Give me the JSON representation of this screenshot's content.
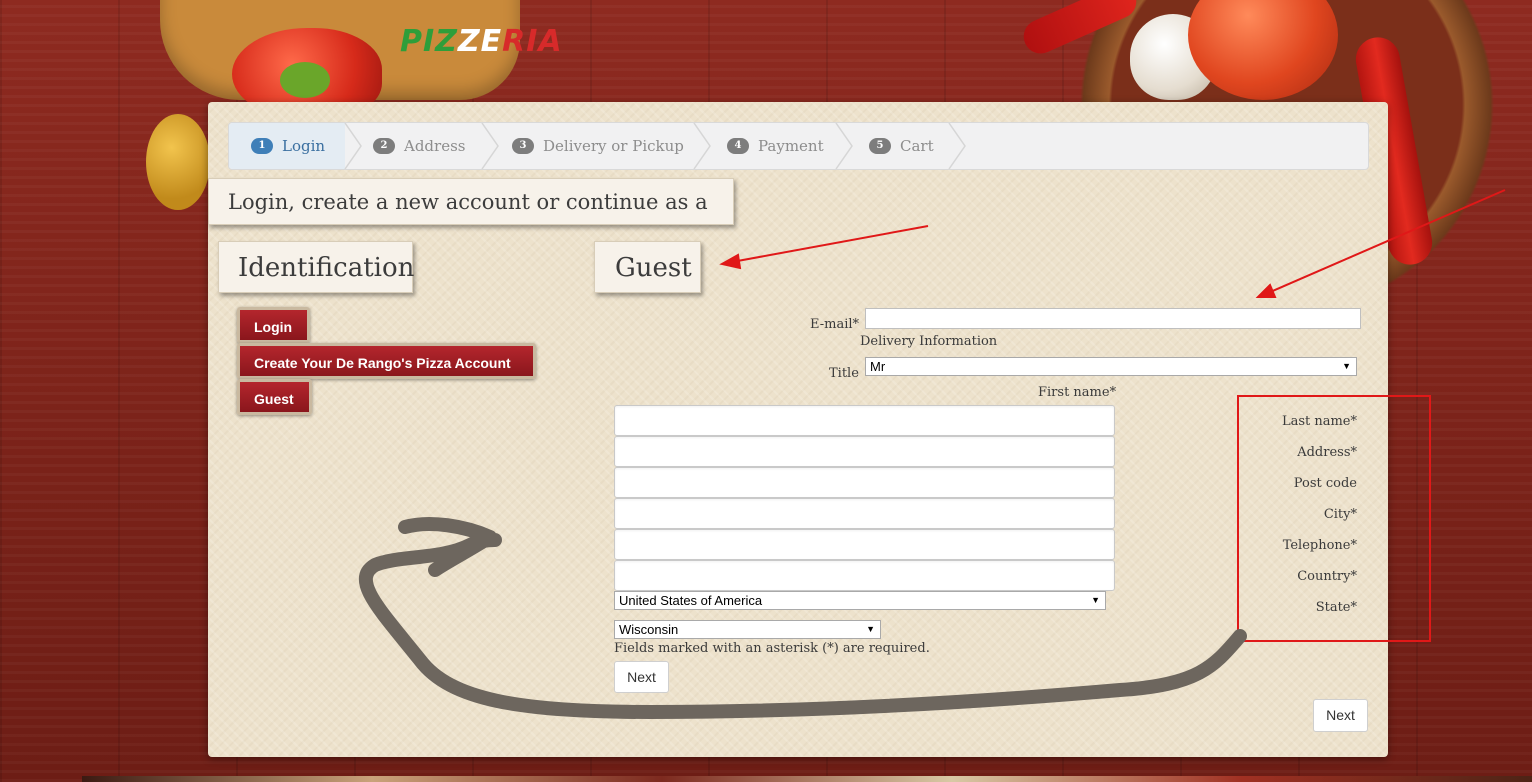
{
  "logo": {
    "part1": "PIZ",
    "part2": "ZE",
    "part3": "RIA"
  },
  "steps": [
    {
      "num": "1",
      "label": "Login"
    },
    {
      "num": "2",
      "label": "Address"
    },
    {
      "num": "3",
      "label": "Delivery or Pickup"
    },
    {
      "num": "4",
      "label": "Payment"
    },
    {
      "num": "5",
      "label": "Cart"
    }
  ],
  "page_heading": "Login, create a new account or continue as a guest",
  "identification": {
    "heading": "Identification",
    "buttons": {
      "login": "Login",
      "create": "Create Your De Rango's Pizza Account",
      "guest": "Guest"
    }
  },
  "guest_form": {
    "heading": "Guest",
    "email_label": "E-mail*",
    "delivery_info": "Delivery Information",
    "title_label": "Title",
    "title_value": "Mr",
    "first_name_label": "First name*",
    "country_value": "United States of America",
    "state_value": "Wisconsin",
    "required_note": "Fields marked with an asterisk (*) are required.",
    "next_label": "Next",
    "right_labels": [
      "Last name*",
      "Address*",
      "Post code",
      "City*",
      "Telephone*",
      "Country*",
      "State*"
    ],
    "next_label_right": "Next"
  },
  "colors": {
    "annotation_red": "#e01818",
    "annotation_gray": "#6d665e",
    "button_red": "#9e1c23"
  }
}
